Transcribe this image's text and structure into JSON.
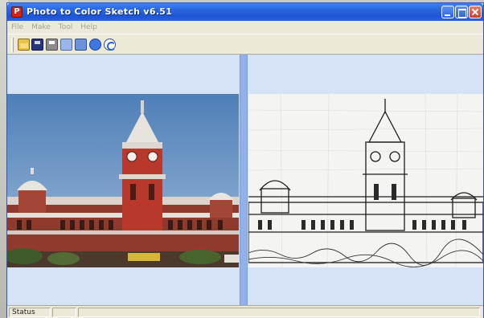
{
  "window": {
    "title": "Photo to Color Sketch v6.51",
    "icon": "app-icon",
    "icon_glyph": "P"
  },
  "menu": {
    "items": [
      "File",
      "Make",
      "Tool",
      "Help"
    ]
  },
  "toolbar": {
    "icons": [
      "open-icon",
      "save-icon",
      "print-icon",
      "rotate-icon",
      "flip-icon",
      "sketch-icon",
      "refresh-icon"
    ]
  },
  "panes": {
    "left": {
      "content": "original-photo",
      "subject": "red brick clock-tower building under a blue sky"
    },
    "right": {
      "content": "pencil-sketch",
      "subject": "black-and-white line sketch of the same building"
    }
  },
  "status": {
    "text": "Status"
  },
  "colors": {
    "titlebar": "#2a64de",
    "client": "#d3e0f5",
    "splitter": "#92b1e6",
    "chrome": "#ece9d8"
  }
}
